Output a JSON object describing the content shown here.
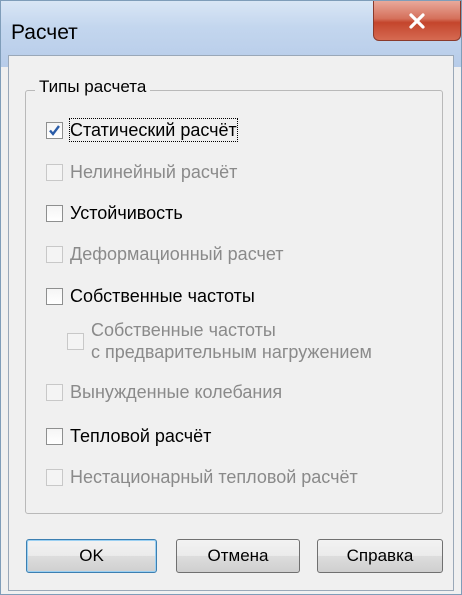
{
  "window": {
    "title": "Расчет"
  },
  "group": {
    "title": "Типы расчета"
  },
  "options": [
    {
      "label": "Статический расчёт",
      "checked": true,
      "enabled": true
    },
    {
      "label": "Нелинейный расчёт",
      "checked": false,
      "enabled": false
    },
    {
      "label": "Устойчивость",
      "checked": false,
      "enabled": true
    },
    {
      "label": "Деформационный расчет",
      "checked": false,
      "enabled": false
    },
    {
      "label": "Собственные частоты",
      "checked": false,
      "enabled": true
    },
    {
      "label_line1": "Собственные частоты",
      "label_line2": "с предварительным нагружением",
      "checked": false,
      "enabled": false
    },
    {
      "label": "Вынужденные колебания",
      "checked": false,
      "enabled": false
    },
    {
      "label": "Тепловой расчёт",
      "checked": false,
      "enabled": true
    },
    {
      "label": "Нестационарный тепловой расчёт",
      "checked": false,
      "enabled": false
    }
  ],
  "buttons": {
    "ok": "OK",
    "cancel": "Отмена",
    "help": "Справка"
  },
  "colors": {
    "window_bg": "#f0f0f0",
    "titlebar": "#c3d6ee",
    "close_button": "#c4452c",
    "check_mark": "#2a5ca8",
    "disabled_text": "#8a8a8a"
  },
  "icons": {
    "close": "close-x-icon",
    "check": "check-mark-icon"
  }
}
